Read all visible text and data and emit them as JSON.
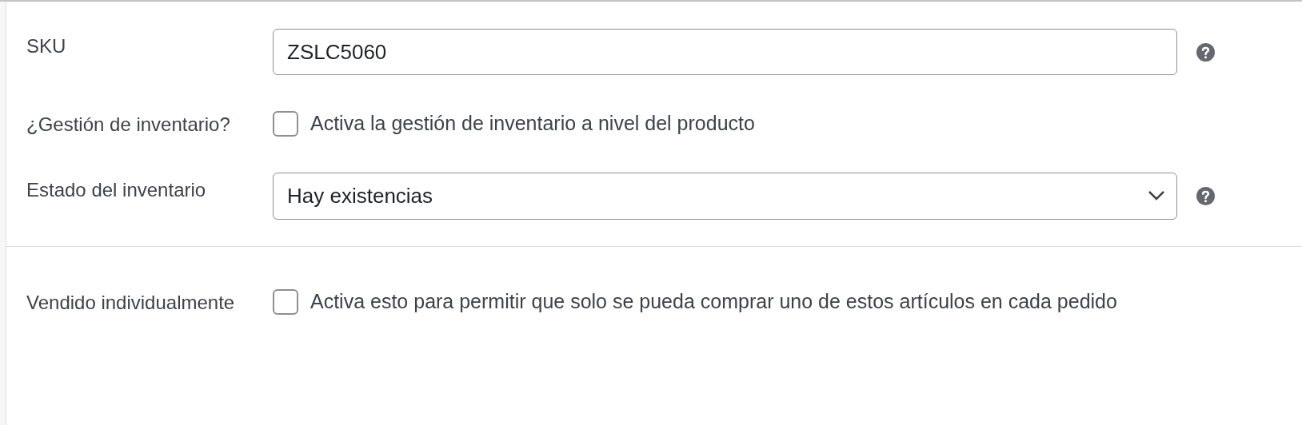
{
  "sections": [
    {
      "rows": [
        {
          "kind": "text",
          "label": "SKU",
          "value": "ZSLC5060",
          "help": true
        },
        {
          "kind": "checkbox",
          "label": "¿Gestión de inventario?",
          "checked": false,
          "text": "Activa la gestión de inventario a nivel del producto"
        },
        {
          "kind": "select",
          "label": "Estado del inventario",
          "value": "Hay existencias",
          "help": true
        }
      ]
    },
    {
      "rows": [
        {
          "kind": "checkbox",
          "label": "Vendido individualmente",
          "checked": false,
          "text": "Activa esto para permitir que solo se pueda comprar uno de estos artículos en cada pedido"
        }
      ]
    }
  ]
}
